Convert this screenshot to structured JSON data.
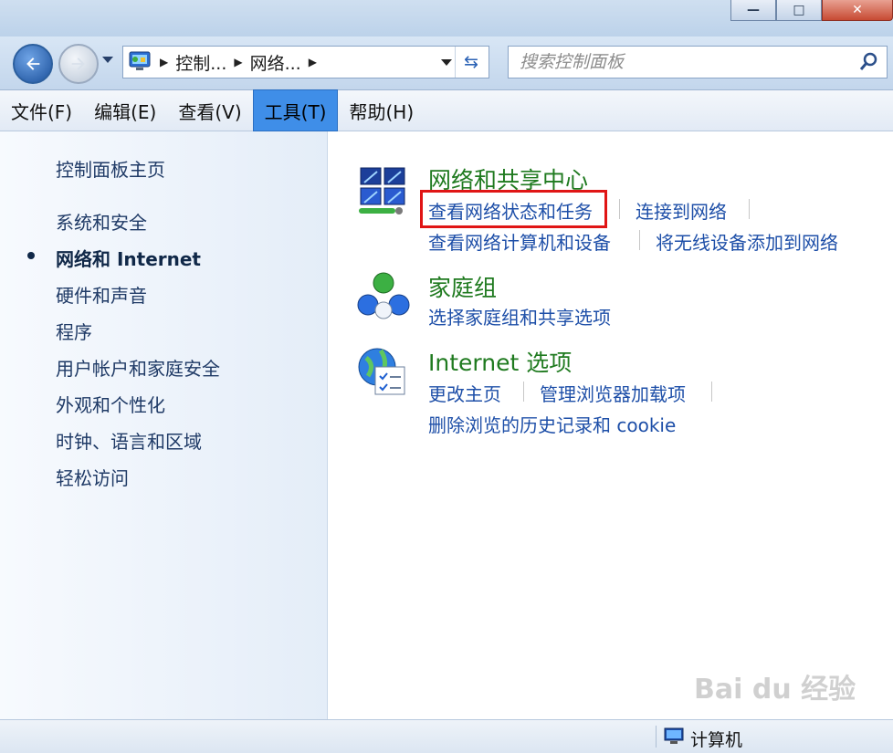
{
  "window": {
    "minimize_glyph": "—",
    "maximize_glyph": "□",
    "close_glyph": "✕"
  },
  "address": {
    "crumbs": [
      "控制...",
      "网络..."
    ],
    "search_placeholder": "搜索控制面板"
  },
  "menu": {
    "items": [
      "文件(F)",
      "编辑(E)",
      "查看(V)",
      "工具(T)",
      "帮助(H)"
    ],
    "active_index": 3
  },
  "sidebar": {
    "items": [
      "控制面板主页",
      "系统和安全",
      "网络和 Internet",
      "硬件和声音",
      "程序",
      "用户帐户和家庭安全",
      "外观和个性化",
      "时钟、语言和区域",
      "轻松访问"
    ],
    "current_index": 2
  },
  "categories": [
    {
      "title": "网络和共享中心",
      "icon": "network-icon",
      "links": [
        "查看网络状态和任务",
        "连接到网络",
        "查看网络计算机和设备",
        "将无线设备添加到网络"
      ]
    },
    {
      "title": "家庭组",
      "icon": "homegroup-icon",
      "links": [
        "选择家庭组和共享选项"
      ]
    },
    {
      "title": "Internet 选项",
      "icon": "internet-options-icon",
      "links": [
        "更改主页",
        "管理浏览器加载项",
        "删除浏览的历史记录和 cookie"
      ]
    }
  ],
  "highlight_color": "#e01515",
  "status": {
    "location": "计算机"
  },
  "watermark": "Bai du 经验"
}
